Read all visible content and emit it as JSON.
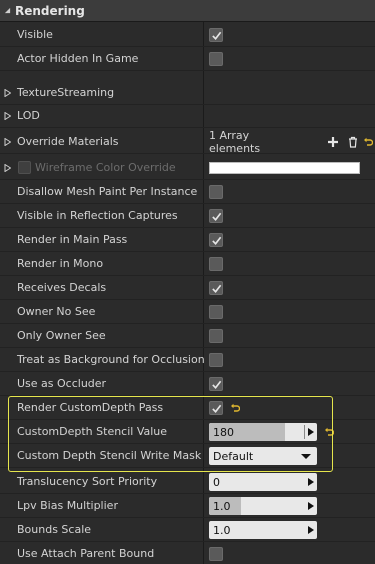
{
  "section": {
    "title": "Rendering"
  },
  "rows": {
    "visible": {
      "label": "Visible",
      "checked": true
    },
    "actor_hidden": {
      "label": "Actor Hidden In Game",
      "checked": false
    },
    "texture_streaming": {
      "label": "TextureStreaming"
    },
    "lod": {
      "label": "LOD"
    },
    "override_materials": {
      "label": "Override Materials",
      "value": "1 Array elements"
    },
    "wireframe": {
      "label": "Wireframe Color Override"
    },
    "disallow_mesh_paint": {
      "label": "Disallow Mesh Paint Per Instance",
      "checked": false
    },
    "visible_reflection": {
      "label": "Visible in Reflection Captures",
      "checked": true
    },
    "render_main_pass": {
      "label": "Render in Main Pass",
      "checked": true
    },
    "render_mono": {
      "label": "Render in Mono",
      "checked": false
    },
    "receives_decals": {
      "label": "Receives Decals",
      "checked": true
    },
    "owner_no_see": {
      "label": "Owner No See",
      "checked": false
    },
    "only_owner_see": {
      "label": "Only Owner See",
      "checked": false
    },
    "treat_background": {
      "label": "Treat as Background for Occlusion",
      "checked": false
    },
    "use_occluder": {
      "label": "Use as Occluder",
      "checked": true
    },
    "render_custom_depth": {
      "label": "Render CustomDepth Pass",
      "checked": true
    },
    "custom_depth_stencil": {
      "label": "CustomDepth Stencil Value",
      "value": "180",
      "fill_fraction": 0.7
    },
    "stencil_write_mask": {
      "label": "Custom Depth Stencil Write Mask",
      "value": "Default"
    },
    "translucency_sort": {
      "label": "Translucency Sort Priority",
      "value": "0"
    },
    "lpv_bias": {
      "label": "Lpv Bias Multiplier",
      "value": "1.0",
      "fill_fraction": 0.3
    },
    "bounds_scale": {
      "label": "Bounds Scale",
      "value": "1.0"
    },
    "attach_parent_bound": {
      "label": "Use Attach Parent Bound",
      "checked": false
    }
  },
  "icons": {
    "expander": "triangle-right-icon",
    "check": "checkmark-icon",
    "reset": "reset-to-default-icon",
    "add": "plus-icon",
    "delete": "trash-icon"
  },
  "colors": {
    "highlight": "#e6e64d",
    "reset_arrow": "#e0b830",
    "panel_bg": "#2b2b2b"
  }
}
